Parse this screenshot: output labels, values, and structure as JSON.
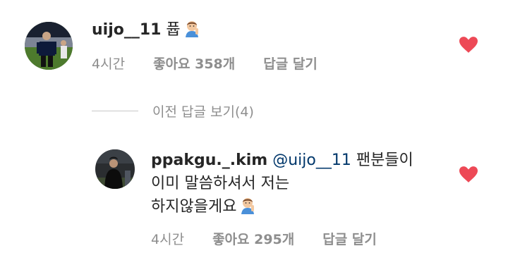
{
  "comment1": {
    "username": "uijo__11",
    "text": "퓹",
    "emoji": "person-gesturing-emoji",
    "time": "4시간",
    "likes": "좋아요 358개",
    "reply": "답글 달기"
  },
  "view_replies": "이전 답글 보기(4)",
  "comment2": {
    "username": "ppakgu._.kim",
    "mention": "@uijo__11",
    "text_line1": "팬분들이",
    "text_line2": "이미 말씀하셔서 저는",
    "text_line3": "하지않을게요",
    "emoji": "person-gesturing-emoji",
    "time": "4시간",
    "likes": "좋아요 295개",
    "reply": "답글 달기"
  },
  "colors": {
    "heart": "#ed4956",
    "meta_text": "#8e8e8e",
    "mention": "#00376b"
  }
}
